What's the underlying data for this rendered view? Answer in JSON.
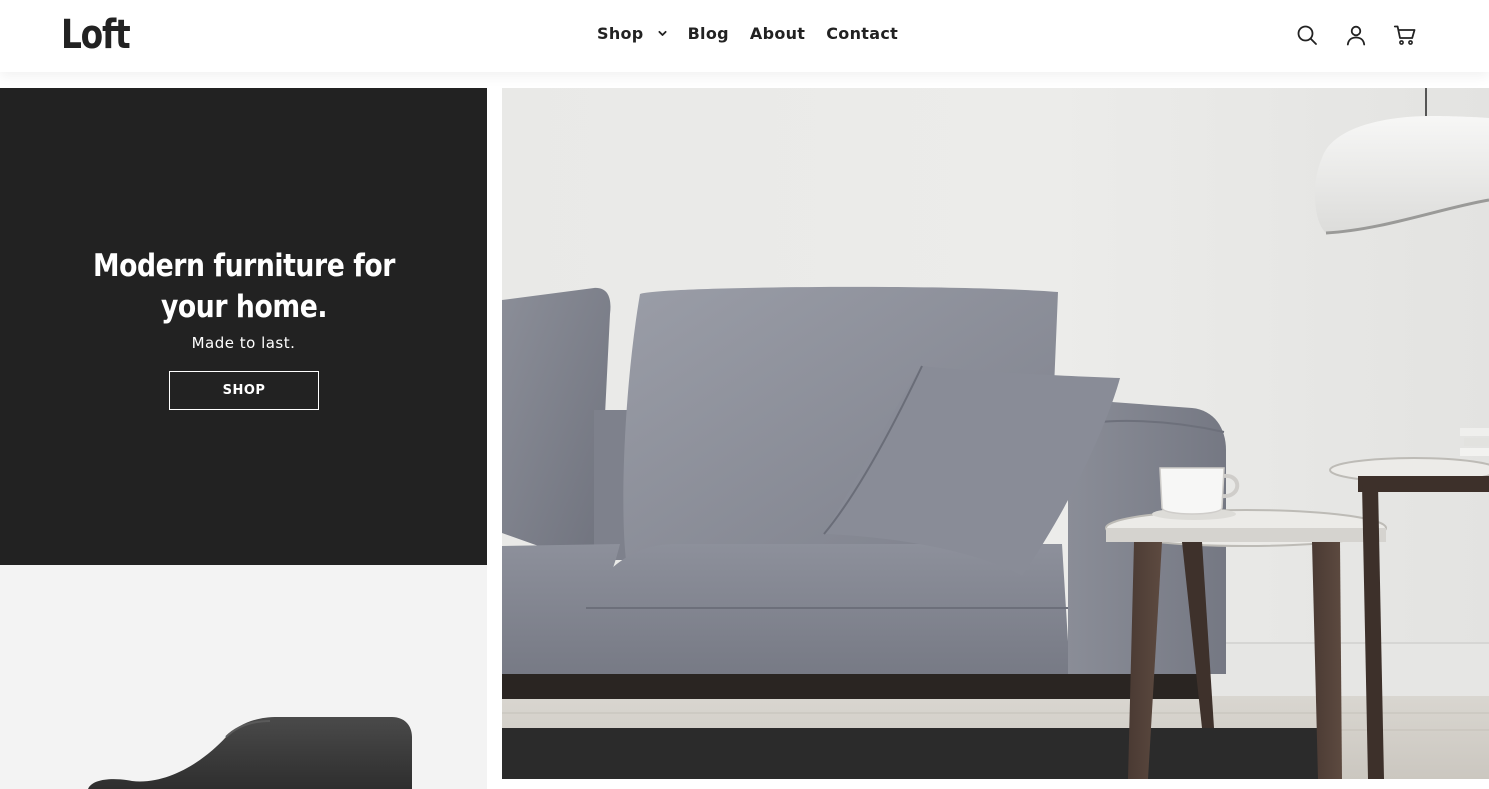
{
  "brand": {
    "logo_text": "Loft"
  },
  "nav": {
    "items": [
      {
        "label": "Shop",
        "has_dropdown": true,
        "icon": "chevron-down-icon"
      },
      {
        "label": "Blog"
      },
      {
        "label": "About"
      },
      {
        "label": "Contact"
      }
    ]
  },
  "header_icons": [
    "search-icon",
    "account-icon",
    "cart-icon"
  ],
  "hero": {
    "title": "Modern furniture for your home.",
    "subtitle": "Made to last.",
    "button_label": "SHOP"
  },
  "colors": {
    "panel_dark": "#222222",
    "header_bg": "#ffffff",
    "text_dark": "#222222",
    "secondary_panel_bg": "#f3f3f3"
  }
}
